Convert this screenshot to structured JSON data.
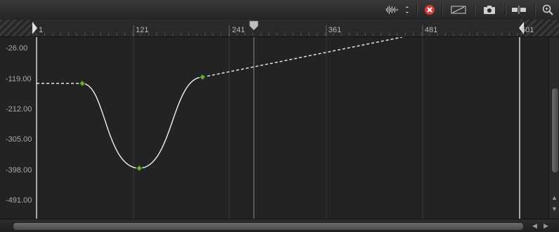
{
  "toolbar": {
    "icons": [
      "audio-waveform-icon",
      "close-icon",
      "transform-icon",
      "camera-icon",
      "clip-icon",
      "zoom-icon"
    ]
  },
  "ruler": {
    "ticks": [
      "1",
      "121",
      "241",
      "361",
      "481",
      "601"
    ]
  },
  "y_axis": {
    "labels": [
      "-26.00",
      "-119.00",
      "-212.00",
      "-305.00",
      "-398.00",
      "-491.00"
    ]
  },
  "curve": {
    "keyframes": [
      {
        "frame": 60,
        "value": -119
      },
      {
        "frame": 129,
        "value": -398
      },
      {
        "frame": 210,
        "value": -101
      }
    ]
  },
  "colors": {
    "curve": "#e6e6e6",
    "keyframe": "#6fb03a",
    "close_icon": "#d33a3a"
  }
}
